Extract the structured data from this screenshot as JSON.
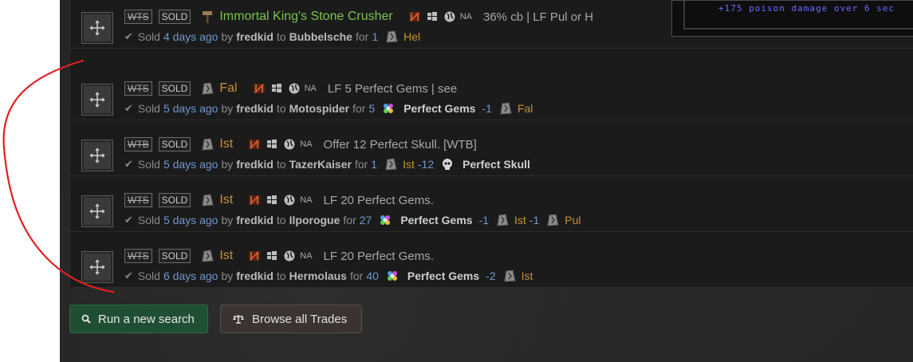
{
  "tooltip": {
    "text": "+175 poison damage over 6 sec"
  },
  "rows": [
    {
      "tag": "WTS",
      "status": "SOLD",
      "item": "Immortal King's Stone Crusher",
      "item_color": "green",
      "desc": "36% cb | LF Pul or H",
      "region": "NA",
      "sold": "Sold",
      "ago": "4 days ago",
      "by": "by",
      "seller": "fredkid",
      "to": "to",
      "buyer": "Bubbelsche",
      "for": "for",
      "qty": "1",
      "price": [
        {
          "icon": "rune-icon",
          "name": "Hel",
          "color": "gold",
          "amt": ""
        }
      ]
    },
    {
      "tag": "WTS",
      "status": "SOLD",
      "item": "Fal",
      "item_color": "gold",
      "desc": "LF 5 Perfect Gems | see",
      "region": "NA",
      "sold": "Sold",
      "ago": "5 days ago",
      "by": "by",
      "seller": "fredkid",
      "to": "to",
      "buyer": "Motospider",
      "for": "for",
      "qty": "5",
      "price": [
        {
          "icon": "gem-icon",
          "name": "Perfect Gems",
          "color": "white",
          "amt": "-1"
        },
        {
          "icon": "rune-icon",
          "name": "Fal",
          "color": "gold",
          "amt": ""
        }
      ]
    },
    {
      "tag": "WTB",
      "status": "SOLD",
      "item": "Ist",
      "item_color": "gold",
      "desc": "Offer 12 Perfect Skull. [WTB]",
      "region": "NA",
      "sold": "Sold",
      "ago": "5 days ago",
      "by": "by",
      "seller": "fredkid",
      "to": "to",
      "buyer": "TazerKaiser",
      "for": "for",
      "qty": "1",
      "price": [
        {
          "icon": "rune-icon",
          "name": "Ist",
          "color": "gold",
          "amt": "-12"
        },
        {
          "icon": "skull-icon",
          "name": "Perfect Skull",
          "color": "white",
          "amt": ""
        }
      ]
    },
    {
      "tag": "WTS",
      "status": "SOLD",
      "item": "Ist",
      "item_color": "gold",
      "desc": "LF 20 Perfect Gems.",
      "region": "NA",
      "sold": "Sold",
      "ago": "5 days ago",
      "by": "by",
      "seller": "fredkid",
      "to": "to",
      "buyer": "Ilporogue",
      "for": "for",
      "qty": "27",
      "price": [
        {
          "icon": "gem-icon",
          "name": "Perfect Gems",
          "color": "white",
          "amt": "-1"
        },
        {
          "icon": "rune-icon",
          "name": "Ist",
          "color": "gold",
          "amt": "-1"
        },
        {
          "icon": "rune-icon",
          "name": "Pul",
          "color": "gold",
          "amt": ""
        }
      ]
    },
    {
      "tag": "WTS",
      "status": "SOLD",
      "item": "Ist",
      "item_color": "gold",
      "desc": "LF 20 Perfect Gems.",
      "region": "NA",
      "sold": "Sold",
      "ago": "6 days ago",
      "by": "by",
      "seller": "fredkid",
      "to": "to",
      "buyer": "Hermolaus",
      "for": "for",
      "qty": "40",
      "price": [
        {
          "icon": "gem-icon",
          "name": "Perfect Gems",
          "color": "white",
          "amt": "-2"
        },
        {
          "icon": "rune-icon",
          "name": "Ist",
          "color": "gold",
          "amt": ""
        }
      ]
    }
  ],
  "buttons": {
    "search": "Run a new search",
    "browse": "Browse all Trades"
  },
  "colors": {
    "green_button": "#1f4f33",
    "gold": "#c7913a",
    "item_green": "#7cc24a",
    "annotation_red": "#e0201f"
  }
}
